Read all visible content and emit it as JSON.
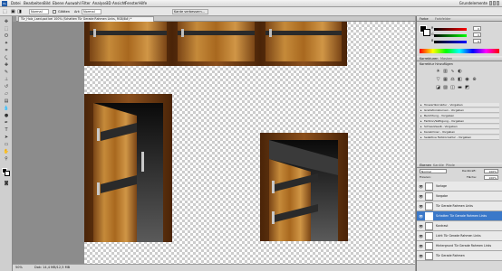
{
  "app": {
    "logo": "Ps",
    "menu": [
      "Datei",
      "Bearbeiten",
      "Bild",
      "Ebene",
      "Auswahl",
      "Filter",
      "Analyse",
      "3D",
      "Ansicht",
      "Fenster",
      "Hilfe"
    ],
    "workspace": "Grundelemente"
  },
  "options": {
    "mode_value": "Normal",
    "anti_alias_label": "Glätten",
    "style_label": "Art:",
    "style_value": "Normal",
    "refine_edge_label": "Kante verbessern..."
  },
  "document": {
    "tab_title": "Tür_Holz_Laed.psd bei 100% (Schatten Tür Gerade Rahmen Links, RGB/8#) *"
  },
  "status": {
    "zoom": "50%",
    "doc_info": "Dok: 14,4 MB/12,5 MB"
  },
  "panels": {
    "color_tabs": [
      "Farbe",
      "Farbfelder"
    ],
    "color_channels": [
      {
        "label": "R",
        "value": "0"
      },
      {
        "label": "G",
        "value": "0"
      },
      {
        "label": "B",
        "value": "0"
      }
    ],
    "adjust_tabs": [
      "Korrekturen",
      "Masken"
    ],
    "adjust_title": "Korrektur hinzufügen",
    "presets": [
      "Tonwertkorrektur - Vorgaben",
      "Gradationskurven - Vorgaben",
      "Belichtung - Vorgaben",
      "Farbton/Sättigung - Vorgaben",
      "Schwarzweiß - Vorgaben",
      "Kanalmixer - Vorgaben",
      "Selektive Farbkorrektur - Vorgaben"
    ],
    "layers_tabs": [
      "Ebenen",
      "Kanäle",
      "Pfade"
    ],
    "blend_mode": "Normal",
    "opacity_label": "Deckkraft:",
    "opacity_value": "100%",
    "lock_label": "Fixieren:",
    "fill_label": "Fläche:",
    "fill_value": "100%",
    "layers": [
      {
        "name": "Vorlage",
        "selected": false
      },
      {
        "name": "Vorgabe",
        "selected": false
      },
      {
        "name": "Tür Gerade Rahmen Links",
        "selected": false
      },
      {
        "name": "Schatten Tür Gerade Rahmen Links",
        "selected": true
      },
      {
        "name": "Kontrast",
        "selected": false
      },
      {
        "name": "Licht Tür Gerade Rahmen Links",
        "selected": false
      },
      {
        "name": "Hintergrund Tür Gerade Rahmen Links",
        "selected": false
      },
      {
        "name": "Tür Gerade Rahmen",
        "selected": false
      }
    ]
  },
  "colors": {
    "accent": "#3a78c9",
    "wood_light": "#b87a2e",
    "wood_dark": "#6a3a12",
    "iron": "#2a2a2a"
  }
}
